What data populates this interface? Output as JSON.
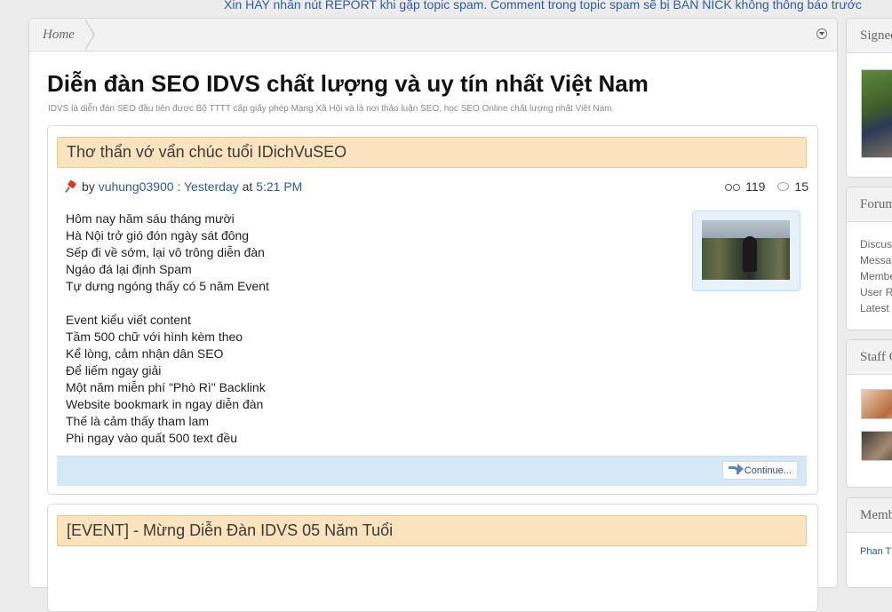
{
  "notice": "Xin HAY nhấn nút REPORT khi gặp topic spam. Comment trong topic spam sẽ bị BAN NICK không thông báo trước",
  "breadcrumb": {
    "home": "Home"
  },
  "page": {
    "title": "Diễn đàn SEO IDVS chất lượng và uy tín nhất Việt Nam",
    "description": "IDVS là diễn đàn SEO đầu tiên được Bộ TTTT cấp giấy phép Mạng Xã Hội và là nơi thảo luận SEO, học SEO Online chất lượng nhất Việt Nam."
  },
  "threads": [
    {
      "title": "Thơ thẩn vớ vẩn chúc tuổi IDichVuSEO",
      "by_label": "by",
      "author": "vuhung03900",
      "separator": ":",
      "date": "Yesterday",
      "at_label": "at",
      "time": "5:21 PM",
      "views": "119",
      "replies": "15",
      "body": [
        "Hôm nay hăm sáu tháng mười",
        "Hà Nội trở gió đón ngày sát đông",
        "Sếp đi về sớm, lại vô trông diễn đàn",
        "Ngáo đá lại định Spam",
        "Tự dưng ngóng thấy có 5 năm Event",
        "",
        "Event kiểu viết content",
        "Tầm 500 chữ với hình kèm theo",
        "Kể lòng, cảm nhận dân SEO",
        "Để liếm ngay giải",
        "Một năm miễn phí \"Phò Rì\" Backlink",
        "Website bookmark in ngay diễn đàn",
        "Thế là cảm thấy tham lam",
        "Phi ngay vào quất 500 text đều"
      ],
      "continue_label": "Continue..."
    },
    {
      "title": "[EVENT] - Mừng Diễn Đàn IDVS 05 Năm Tuổi"
    }
  ],
  "sidebar": {
    "signed_in": "Signed",
    "forum_stats": "Forum",
    "stats_items": [
      "Discus",
      "Messa",
      "Membe",
      "User R",
      "Latest"
    ],
    "staff": "Staff C",
    "members": "Memb",
    "member_link": "Phan T"
  },
  "icons": {
    "pin": "pin-icon",
    "views": "views-icon",
    "replies": "replies-icon",
    "continue": "continue-arrow-icon",
    "jump": "jump-menu-icon"
  },
  "colors": {
    "title_bar": "#fbe3bd",
    "footer": "#d6e8f6",
    "link": "#2d5c93",
    "notice": "#2d5ba3"
  }
}
